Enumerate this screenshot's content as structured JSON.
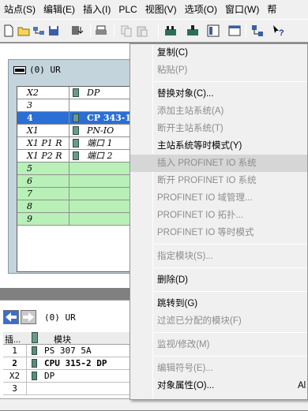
{
  "menubar": {
    "items": [
      "站点(S)",
      "编辑(E)",
      "插入(I)",
      "PLC",
      "视图(V)",
      "选项(O)",
      "窗口(W)",
      "帮"
    ]
  },
  "toolbar": {
    "icons": [
      "new-icon",
      "open-icon",
      "accessible-nodes-icon",
      "save-icon",
      "download-icon",
      "print-icon",
      "copy-icon",
      "paste-icon",
      "catalog-icon",
      "config-icon",
      "network-icon",
      "view-icon",
      "help-pointer-icon"
    ]
  },
  "station": {
    "title": "(0) UR",
    "rows": [
      {
        "slot": "X2",
        "module": "DP",
        "type": "normal"
      },
      {
        "slot": "3",
        "module": "",
        "type": "normal"
      },
      {
        "slot": "4",
        "module": "CP 343-1",
        "type": "selected"
      },
      {
        "slot": "X1",
        "module": "PN-IO",
        "type": "normal"
      },
      {
        "slot": "X1 P1 R",
        "module": "端口 1",
        "type": "normal"
      },
      {
        "slot": "X1 P2 R",
        "module": "端口 2",
        "type": "normal"
      },
      {
        "slot": "5",
        "module": "",
        "type": "green"
      },
      {
        "slot": "6",
        "module": "",
        "type": "green"
      },
      {
        "slot": "7",
        "module": "",
        "type": "green"
      },
      {
        "slot": "8",
        "module": "",
        "type": "green"
      },
      {
        "slot": "9",
        "module": "",
        "type": "green"
      }
    ]
  },
  "lower": {
    "title": "(0)   UR",
    "headers": {
      "slot": "插...",
      "module": "模块"
    },
    "rows": [
      {
        "slot": "1",
        "module": "PS 307 5A",
        "bold": false
      },
      {
        "slot": "2",
        "module": "CPU 315-2 DP",
        "bold": true
      },
      {
        "slot": "X2",
        "module": "DP",
        "bold": false
      },
      {
        "slot": "3",
        "module": "",
        "bold": false
      }
    ]
  },
  "context_menu": {
    "items": [
      {
        "label": "复制(C)",
        "enabled": true
      },
      {
        "label": "粘贴(P)",
        "enabled": false
      },
      {
        "sep": true
      },
      {
        "label": "替换对象(C)...",
        "enabled": true
      },
      {
        "label": "添加主站系统(A)",
        "enabled": false
      },
      {
        "label": "断开主站系统(T)",
        "enabled": false
      },
      {
        "label": "主站系统等时模式(Y)",
        "enabled": true
      },
      {
        "label": "插入 PROFINET IO 系统",
        "enabled": false,
        "highlight": true
      },
      {
        "label": "断开 PROFINET IO 系统",
        "enabled": false
      },
      {
        "label": "PROFINET IO 域管理...",
        "enabled": false
      },
      {
        "label": "PROFINET IO 拓扑...",
        "enabled": false
      },
      {
        "label": "PROFINET IO 等时模式",
        "enabled": false
      },
      {
        "sep": true
      },
      {
        "label": "指定模块(S)...",
        "enabled": false
      },
      {
        "sep": true
      },
      {
        "label": "删除(D)",
        "enabled": true
      },
      {
        "sep": true
      },
      {
        "label": "跳转到(G)",
        "enabled": true
      },
      {
        "label": "过滤已分配的模块(F)",
        "enabled": false
      },
      {
        "sep": true
      },
      {
        "label": "监视/修改(M)",
        "enabled": false
      },
      {
        "sep": true
      },
      {
        "label": "编辑符号(E)...",
        "enabled": false
      },
      {
        "label": "对象属性(O)...",
        "enabled": true,
        "accel": "Al"
      }
    ]
  }
}
